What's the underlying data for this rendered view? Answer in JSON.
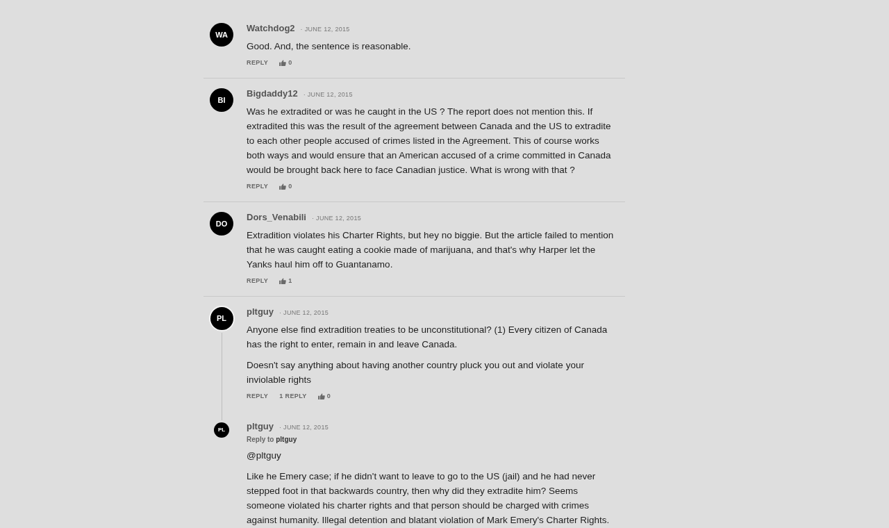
{
  "comments": [
    {
      "avatar": "WA",
      "author": "Watchdog2",
      "date": "· JUNE 12, 2015",
      "paragraphs": [
        "Good. And, the sentence is reasonable."
      ],
      "reply_button": "REPLY",
      "likes": "0"
    },
    {
      "avatar": "BI",
      "author": "Bigdaddy12",
      "date": "· JUNE 12, 2015",
      "paragraphs": [
        "Was he extradited or was he caught in the US ? The report does not mention this. If extradited this was the result of the agreement between Canada and the US to extradite to each other people accused of crimes listed in the Agreement. This of course works both ways and would ensure that an American accused of a crime committed in Canada would be brought back here to face Canadian justice. What is wrong with that ?"
      ],
      "reply_button": "REPLY",
      "likes": "0"
    },
    {
      "avatar": "DO",
      "author": "Dors_Venabili",
      "date": "· JUNE 12, 2015",
      "paragraphs": [
        "Extradition violates his Charter Rights, but hey no biggie. But the article failed to mention that he was caught eating a cookie made of marijuana, and that's why Harper let the Yanks haul him off to Guantanamo."
      ],
      "reply_button": "REPLY",
      "likes": "1"
    },
    {
      "avatar": "PL",
      "author": "pltguy",
      "date": "· JUNE 12, 2015",
      "paragraphs": [
        "Anyone else find extradition treaties to be unconstitutional? (1) Every citizen of Canada has the right to enter, remain in and leave Canada.",
        "Doesn't say anything about having another country pluck you out and violate your inviolable rights"
      ],
      "reply_button": "REPLY",
      "replies_link": "1 REPLY",
      "likes": "0",
      "children": [
        {
          "avatar": "PL",
          "author": "pltguy",
          "date": "· JUNE 12, 2015",
          "reply_to": {
            "label": "Reply to",
            "author": "pltguy"
          },
          "paragraphs": [
            "@pltguy",
            "Like he Emery case; if he didn't want to leave to go to the US (jail) and he had never stepped foot in that backwards country, then why did they extradite him? Seems someone violated his charter rights and that person should be charged with crimes against humanity. Illegal detention and blatant violation of Mark Emery's Charter Rights."
          ]
        }
      ]
    }
  ]
}
